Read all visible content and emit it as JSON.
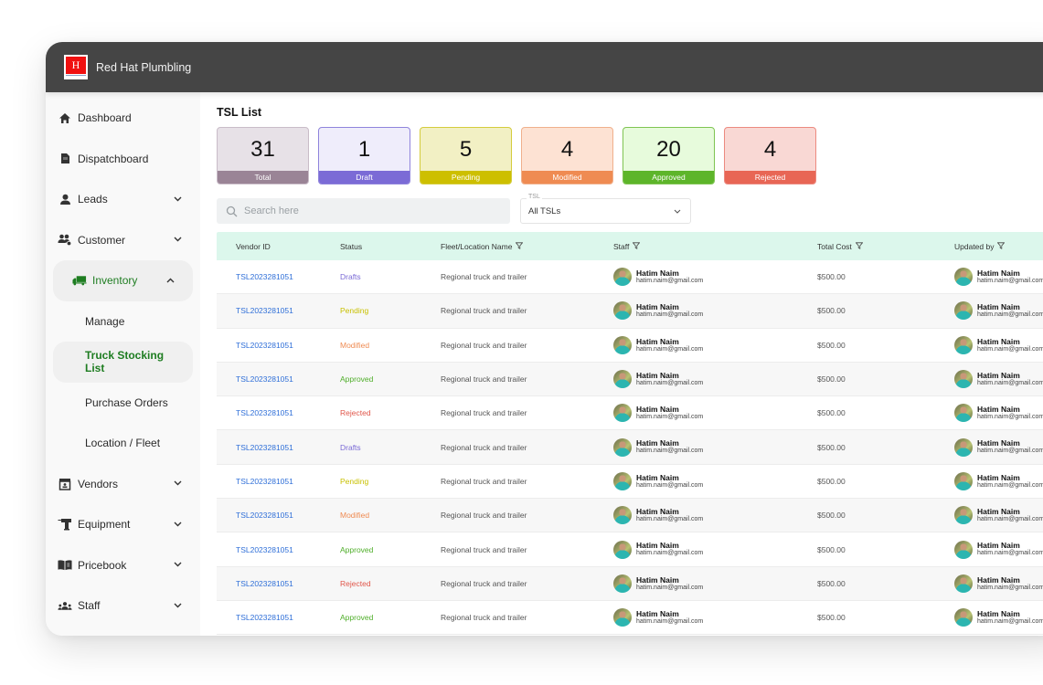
{
  "app": {
    "brand_name": "Red Hat Plumbling",
    "logo_glyph": "H"
  },
  "sidebar": {
    "items": [
      {
        "label": "Dashboard",
        "icon": "home-icon",
        "expandable": false
      },
      {
        "label": "Dispatchboard",
        "icon": "document-icon",
        "expandable": false
      },
      {
        "label": "Leads",
        "icon": "person-icon",
        "expandable": true,
        "chevron": "⌄"
      },
      {
        "label": "Customer",
        "icon": "customers-icon",
        "expandable": true,
        "chevron": "⌄"
      },
      {
        "label": "Inventory",
        "icon": "truck-icon",
        "expandable": true,
        "expanded": true,
        "chevron": "⌃"
      },
      {
        "label": "Vendors",
        "icon": "store-icon",
        "expandable": true,
        "chevron": "⌄"
      },
      {
        "label": "Equipment",
        "icon": "drill-icon",
        "expandable": true,
        "chevron": "⌄"
      },
      {
        "label": "Pricebook",
        "icon": "book-icon",
        "expandable": true,
        "chevron": "⌄"
      },
      {
        "label": "Staff",
        "icon": "group-icon",
        "expandable": true,
        "chevron": "⌄"
      }
    ],
    "inventory_sub": [
      {
        "label": "Manage"
      },
      {
        "label": "Truck Stocking List",
        "active": true
      },
      {
        "label": "Purchase Orders"
      },
      {
        "label": "Location / Fleet"
      }
    ]
  },
  "main": {
    "title": "TSL List",
    "cards": [
      {
        "value": "31",
        "label": "Total",
        "bg": "#e7e1e7",
        "border": "#c9bcc8",
        "bar": "#9a8496"
      },
      {
        "value": "1",
        "label": "Draft",
        "bg": "#efedfb",
        "border": "#8f84dc",
        "bar": "#7b6bd6"
      },
      {
        "value": "5",
        "label": "Pending",
        "bg": "#f2f0c4",
        "border": "#d4cc3c",
        "bar": "#cdbf00"
      },
      {
        "value": "4",
        "label": "Modified",
        "bg": "#fde2d3",
        "border": "#f0b08c",
        "bar": "#ef8b52"
      },
      {
        "value": "20",
        "label": "Approved",
        "bg": "#e7fbdc",
        "border": "#7fc452",
        "bar": "#5db52a"
      },
      {
        "value": "4",
        "label": "Rejected",
        "bg": "#f9d8d4",
        "border": "#ec8a80",
        "bar": "#e86655"
      }
    ],
    "search": {
      "placeholder": "Search here"
    },
    "tsl_select": {
      "label": "TSL",
      "value": "All TSLs",
      "chevron": "⌄"
    },
    "table": {
      "columns": [
        {
          "label": "Vendor ID",
          "filter": false
        },
        {
          "label": "Status",
          "filter": false
        },
        {
          "label": "Fleet/Location Name",
          "filter": true
        },
        {
          "label": "Staff",
          "filter": true
        },
        {
          "label": "Total Cost",
          "filter": true
        },
        {
          "label": "Updated by",
          "filter": true
        }
      ],
      "filter_glyph": "⊽",
      "status_colors": {
        "Drafts": "#7b6bd6",
        "Pending": "#c8c000",
        "Modified": "#ef8b52",
        "Approved": "#4fae2a",
        "Rejected": "#e0564a"
      },
      "rows": [
        {
          "vendor_id": "TSL2023281051",
          "status": "Drafts",
          "fleet": "Regional truck and trailer",
          "staff_name": "Hatim Naim",
          "staff_email": "hatim.naim@gmail.com",
          "total_cost": "$500.00",
          "updated_name": "Hatim Naim",
          "updated_email": "hatim.naim@gmail.com"
        },
        {
          "vendor_id": "TSL2023281051",
          "status": "Pending",
          "fleet": "Regional truck and trailer",
          "staff_name": "Hatim Naim",
          "staff_email": "hatim.naim@gmail.com",
          "total_cost": "$500.00",
          "updated_name": "Hatim Naim",
          "updated_email": "hatim.naim@gmail.com"
        },
        {
          "vendor_id": "TSL2023281051",
          "status": "Modified",
          "fleet": "Regional truck and trailer",
          "staff_name": "Hatim Naim",
          "staff_email": "hatim.naim@gmail.com",
          "total_cost": "$500.00",
          "updated_name": "Hatim Naim",
          "updated_email": "hatim.naim@gmail.com"
        },
        {
          "vendor_id": "TSL2023281051",
          "status": "Approved",
          "fleet": "Regional truck and trailer",
          "staff_name": "Hatim Naim",
          "staff_email": "hatim.naim@gmail.com",
          "total_cost": "$500.00",
          "updated_name": "Hatim Naim",
          "updated_email": "hatim.naim@gmail.com"
        },
        {
          "vendor_id": "TSL2023281051",
          "status": "Rejected",
          "fleet": "Regional truck and trailer",
          "staff_name": "Hatim Naim",
          "staff_email": "hatim.naim@gmail.com",
          "total_cost": "$500.00",
          "updated_name": "Hatim Naim",
          "updated_email": "hatim.naim@gmail.com"
        },
        {
          "vendor_id": "TSL2023281051",
          "status": "Drafts",
          "fleet": "Regional truck and trailer",
          "staff_name": "Hatim Naim",
          "staff_email": "hatim.naim@gmail.com",
          "total_cost": "$500.00",
          "updated_name": "Hatim Naim",
          "updated_email": "hatim.naim@gmail.com"
        },
        {
          "vendor_id": "TSL2023281051",
          "status": "Pending",
          "fleet": "Regional truck and trailer",
          "staff_name": "Hatim Naim",
          "staff_email": "hatim.naim@gmail.com",
          "total_cost": "$500.00",
          "updated_name": "Hatim Naim",
          "updated_email": "hatim.naim@gmail.com"
        },
        {
          "vendor_id": "TSL2023281051",
          "status": "Modified",
          "fleet": "Regional truck and trailer",
          "staff_name": "Hatim Naim",
          "staff_email": "hatim.naim@gmail.com",
          "total_cost": "$500.00",
          "updated_name": "Hatim Naim",
          "updated_email": "hatim.naim@gmail.com"
        },
        {
          "vendor_id": "TSL2023281051",
          "status": "Approved",
          "fleet": "Regional truck and trailer",
          "staff_name": "Hatim Naim",
          "staff_email": "hatim.naim@gmail.com",
          "total_cost": "$500.00",
          "updated_name": "Hatim Naim",
          "updated_email": "hatim.naim@gmail.com"
        },
        {
          "vendor_id": "TSL2023281051",
          "status": "Rejected",
          "fleet": "Regional truck and trailer",
          "staff_name": "Hatim Naim",
          "staff_email": "hatim.naim@gmail.com",
          "total_cost": "$500.00",
          "updated_name": "Hatim Naim",
          "updated_email": "hatim.naim@gmail.com"
        },
        {
          "vendor_id": "TSL2023281051",
          "status": "Approved",
          "fleet": "Regional truck and trailer",
          "staff_name": "Hatim Naim",
          "staff_email": "hatim.naim@gmail.com",
          "total_cost": "$500.00",
          "updated_name": "Hatim Naim",
          "updated_email": "hatim.naim@gmail.com"
        }
      ]
    }
  }
}
